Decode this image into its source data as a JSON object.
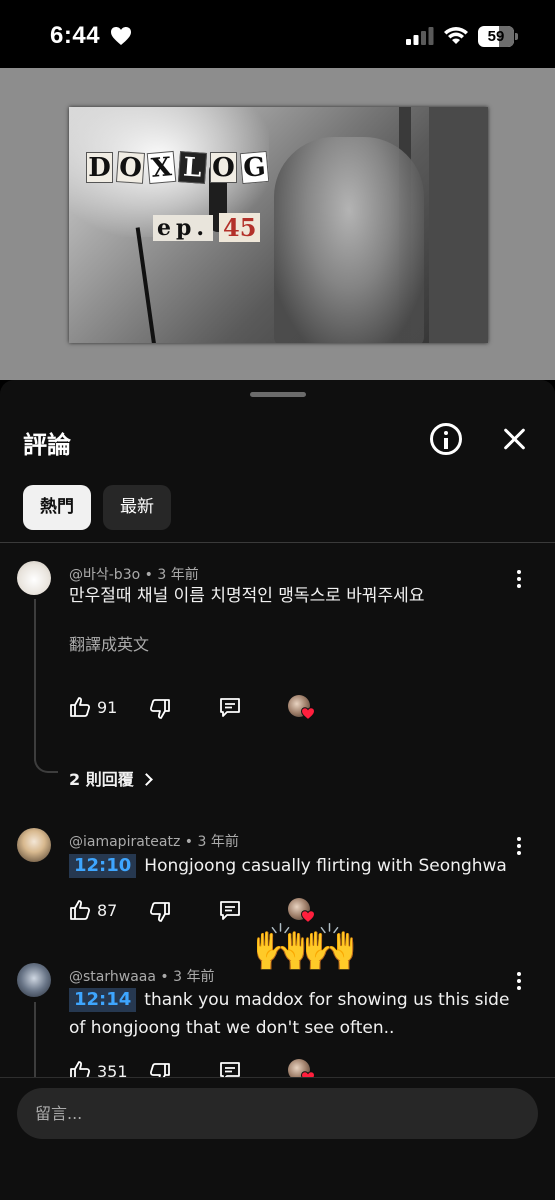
{
  "status_bar": {
    "time": "6:44",
    "battery": "59"
  },
  "video": {
    "title_letters": [
      "D",
      "O",
      "X",
      "L",
      "O",
      "G"
    ],
    "episode_label": "ep.",
    "episode_number": "45"
  },
  "comments_panel": {
    "title": "評論",
    "chips": [
      "熱門",
      "最新"
    ],
    "input_placeholder": "留言..."
  },
  "comments": [
    {
      "author": "@바삭-b3o",
      "age": "3 年前",
      "text": "만우절때 채널 이름 치명적인 맹독스로 바꿔주세요",
      "translate": "翻譯成英文",
      "likes": "91",
      "replies": "2 則回覆"
    },
    {
      "author": "@iamapirateatz",
      "age": "3 年前",
      "timestamp": "12:10",
      "text": "Hongjoong casually flirting with Seonghwa",
      "likes": "87"
    },
    {
      "author": "@starhwaaa",
      "age": "3 年前",
      "timestamp": "12:14",
      "text": "thank you maddox for showing us this side of hongjoong that we don't see often..",
      "likes": "351"
    }
  ],
  "emoji_overlay": "🙌🙌",
  "colors": {
    "sheet_background": "#0f0f0f",
    "timestamp_background": "#263850",
    "timestamp_text": "#3ea6ff",
    "heart_red": "#ff1f3d"
  }
}
